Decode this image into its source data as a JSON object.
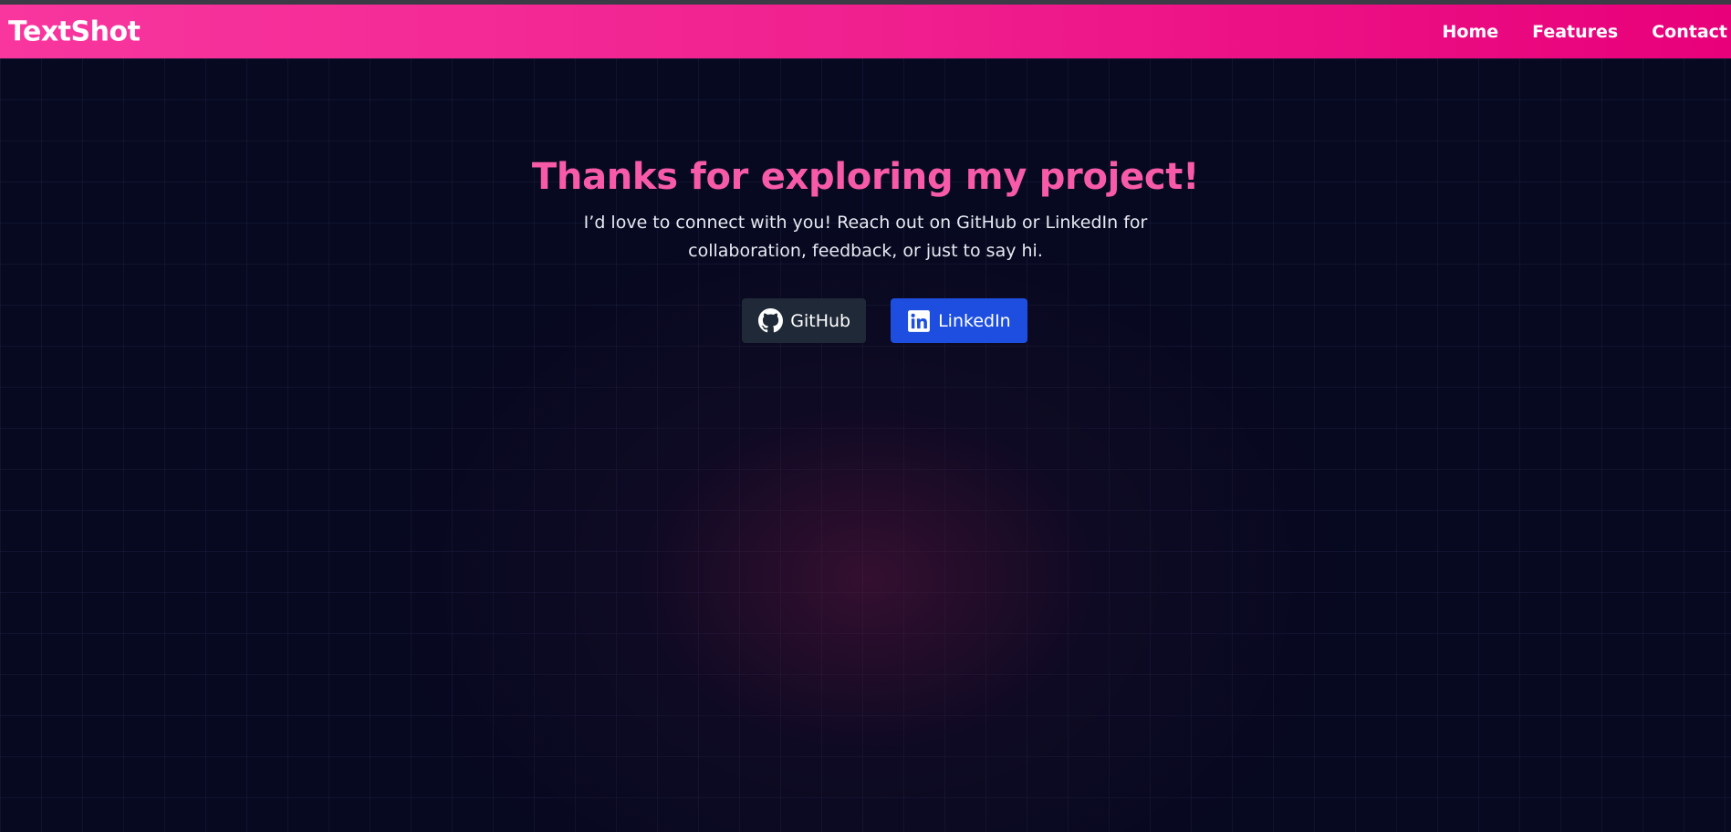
{
  "nav": {
    "brand": "TextShot",
    "links": [
      "Home",
      "Features",
      "Contact"
    ]
  },
  "hero": {
    "title": "Thanks for exploring my project!",
    "subtitle": "I’d love to connect with you! Reach out on GitHub or LinkedIn for collaboration, feedback, or just to say hi.",
    "buttons": {
      "github": "GitHub",
      "linkedin": "LinkedIn"
    }
  },
  "colors": {
    "navbar_gradient_start": "#f8369e",
    "navbar_gradient_end": "#e8007a",
    "title": "#f75aa8",
    "background": "#060920",
    "github_button": "#1f2937",
    "linkedin_button": "#1d4ee0"
  },
  "icons": {
    "github_button": "github-icon",
    "linkedin_button": "linkedin-icon"
  }
}
